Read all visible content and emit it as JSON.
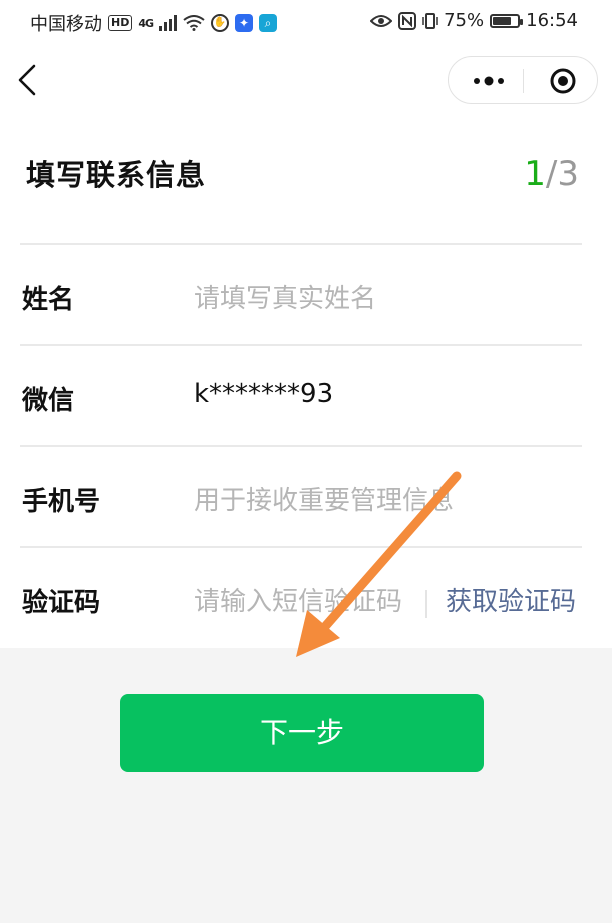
{
  "status_bar": {
    "carrier": "中国移动",
    "hd": "HD",
    "network": "4G",
    "battery": "75%",
    "battery_level": 0.75,
    "time": "16:54"
  },
  "nav": {
    "back_icon": "chevron-left-icon",
    "more_icon": "more-dots-icon",
    "close_icon": "target-circle-icon"
  },
  "header": {
    "title": "填写联系信息",
    "step_current": "1",
    "step_total": "/3"
  },
  "form": {
    "name": {
      "label": "姓名",
      "placeholder": "请填写真实姓名"
    },
    "wechat": {
      "label": "微信",
      "value": "k*******93"
    },
    "phone": {
      "label": "手机号",
      "placeholder": "用于接收重要管理信息"
    },
    "code": {
      "label": "验证码",
      "placeholder": "请输入短信验证码",
      "button": "获取验证码"
    }
  },
  "next_button": "下一步",
  "colors": {
    "accent_green": "#07c160",
    "step_green": "#1aad19",
    "link_blue": "#576b95",
    "annotation_orange": "#f48b3b"
  }
}
